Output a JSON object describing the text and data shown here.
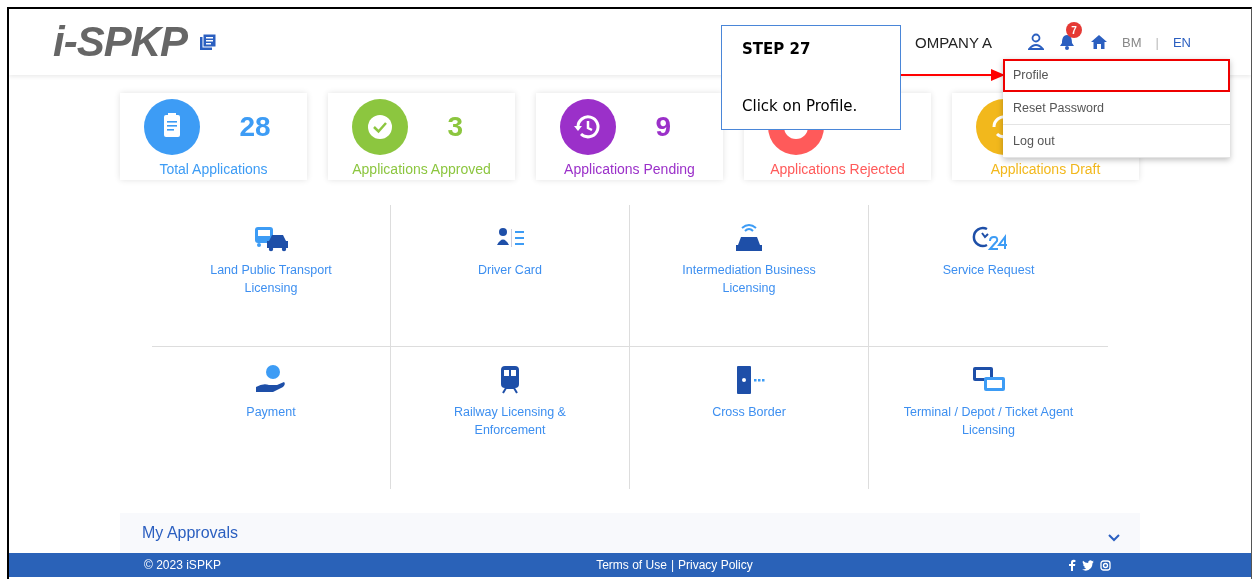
{
  "header": {
    "logo": "i-SPKP",
    "company": "OMPANY A",
    "notification_count": "7",
    "language_separator": "|",
    "languages": [
      {
        "label": "BM",
        "selected": false
      },
      {
        "label": "EN",
        "selected": true
      }
    ]
  },
  "callout": {
    "title": "STEP 27",
    "text": "Click on Profile."
  },
  "user_menu": {
    "items": [
      {
        "label": "Profile",
        "highlighted": true
      },
      {
        "label": "Reset Password",
        "highlighted": false
      },
      {
        "label": "Log out",
        "highlighted": false
      }
    ]
  },
  "stats": [
    {
      "kind": "total",
      "count": "28",
      "label": "Total Applications",
      "color": "#3d9cf5"
    },
    {
      "kind": "approved",
      "count": "3",
      "label": "Applications Approved",
      "color": "#8cc63f"
    },
    {
      "kind": "pending",
      "count": "9",
      "label": "Applications Pending",
      "color": "#9b30c9"
    },
    {
      "kind": "rejected",
      "label": "Applications Rejected",
      "color": "#ff5a5a"
    },
    {
      "kind": "draft",
      "label": "Applications Draft",
      "color": "#f2b81c"
    }
  ],
  "services": [
    {
      "kind": "transport",
      "label": "Land Public Transport\nLicensing"
    },
    {
      "kind": "driver",
      "label": "Driver Card"
    },
    {
      "kind": "intermediation",
      "label": "Intermediation Business\nLicensing"
    },
    {
      "kind": "service",
      "label": "Service Request"
    },
    {
      "kind": "payment",
      "label": "Payment"
    },
    {
      "kind": "railway",
      "label": "Railway Licensing &\nEnforcement"
    },
    {
      "kind": "border",
      "label": "Cross Border"
    },
    {
      "kind": "terminal",
      "label": "Terminal / Depot / Ticket Agent\nLicensing"
    }
  ],
  "my_approvals": {
    "title": "My Approvals",
    "expanded": false
  },
  "footer": {
    "copyright": "© 2023 iSPKP",
    "links": [
      "Terms of Use",
      "Privacy Policy"
    ],
    "separator": "|"
  }
}
